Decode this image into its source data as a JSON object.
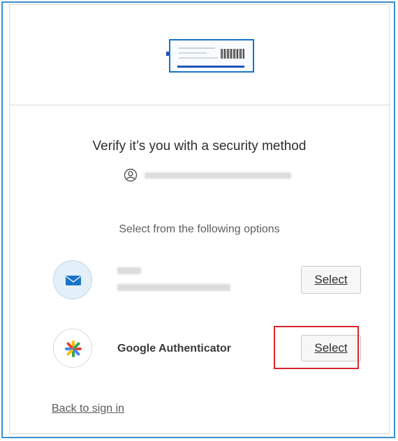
{
  "dialog": {
    "title": "Verify it’s you with a security method",
    "user_icon": "user-circle-icon",
    "subtitle": "Select from the following options",
    "back_link": "Back to sign in"
  },
  "methods": [
    {
      "icon": "email-envelope-icon",
      "select_label": "Select"
    },
    {
      "icon": "google-authenticator-icon",
      "label": "Google Authenticator",
      "select_label": "Select"
    }
  ],
  "colors": {
    "border": "#3a8fd0",
    "highlight": "#d9262b",
    "email_icon": "#1a73c8"
  }
}
